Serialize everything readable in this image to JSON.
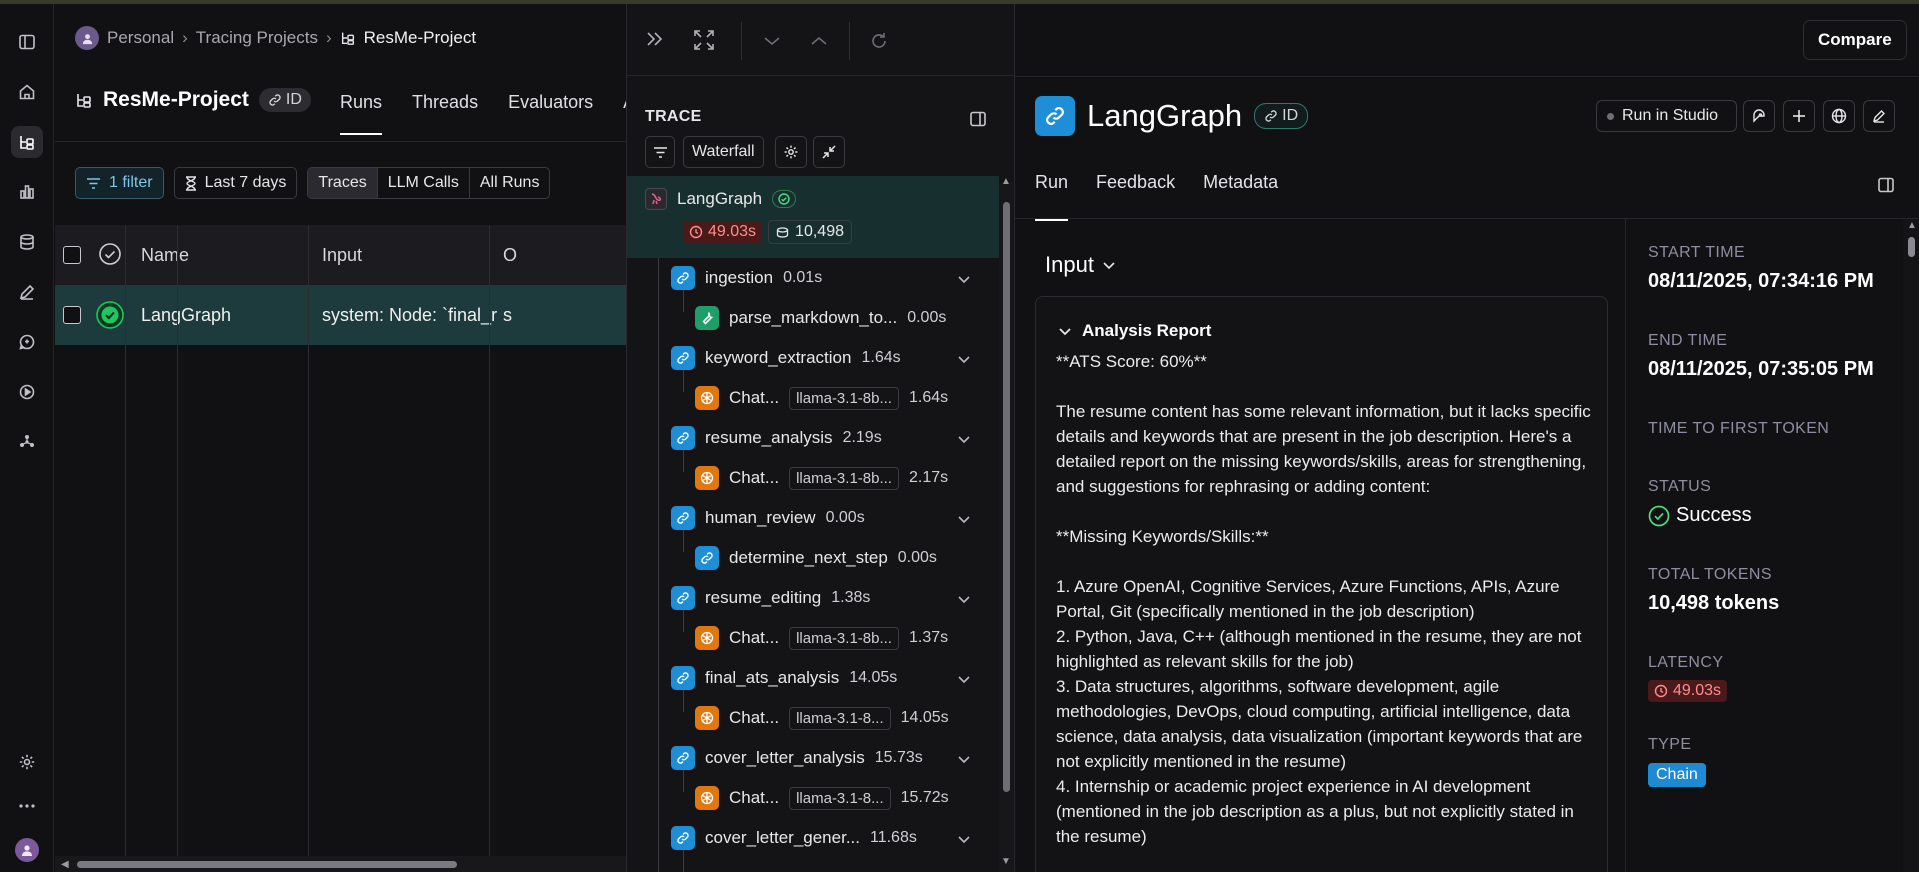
{
  "breadcrumb": {
    "root": "Personal",
    "mid": "Tracing Projects",
    "current": "ResMe-Project"
  },
  "project": {
    "title": "ResMe-Project",
    "id_label": "ID"
  },
  "project_tabs": [
    "Runs",
    "Threads",
    "Evaluators",
    "A"
  ],
  "filters": {
    "filter_label": "1 filter",
    "time_label": "Last 7 days",
    "segments": [
      "Traces",
      "LLM Calls",
      "All Runs"
    ]
  },
  "table": {
    "columns": [
      "Name",
      "Input",
      "O"
    ],
    "rows": [
      {
        "name": "LangGraph",
        "input": "system: Node: `final_r...",
        "output": "s"
      }
    ]
  },
  "trace": {
    "section_label": "TRACE",
    "view_label": "Waterfall",
    "root": {
      "name": "LangGraph",
      "latency": "49.03s",
      "tokens": "10,498"
    },
    "nodes": [
      {
        "name": "ingestion",
        "dur": "0.01s",
        "kind": "chain"
      },
      {
        "name": "parse_markdown_to...",
        "dur": "0.00s",
        "kind": "tool"
      },
      {
        "name": "keyword_extraction",
        "dur": "1.64s",
        "kind": "chain"
      },
      {
        "name": "Chat...",
        "model": "llama-3.1-8b...",
        "dur": "1.64s",
        "kind": "llm"
      },
      {
        "name": "resume_analysis",
        "dur": "2.19s",
        "kind": "chain"
      },
      {
        "name": "Chat...",
        "model": "llama-3.1-8b...",
        "dur": "2.17s",
        "kind": "llm"
      },
      {
        "name": "human_review",
        "dur": "0.00s",
        "kind": "chain"
      },
      {
        "name": "determine_next_step",
        "dur": "0.00s",
        "kind": "chain"
      },
      {
        "name": "resume_editing",
        "dur": "1.38s",
        "kind": "chain"
      },
      {
        "name": "Chat...",
        "model": "llama-3.1-8b...",
        "dur": "1.37s",
        "kind": "llm"
      },
      {
        "name": "final_ats_analysis",
        "dur": "14.05s",
        "kind": "chain"
      },
      {
        "name": "Chat...",
        "model": "llama-3.1-8...",
        "dur": "14.05s",
        "kind": "llm"
      },
      {
        "name": "cover_letter_analysis",
        "dur": "15.73s",
        "kind": "chain"
      },
      {
        "name": "Chat...",
        "model": "llama-3.1-8...",
        "dur": "15.72s",
        "kind": "llm"
      },
      {
        "name": "cover_letter_gener...",
        "dur": "11.68s",
        "kind": "chain"
      }
    ]
  },
  "detail": {
    "title": "LangGraph",
    "id_label": "ID",
    "run_in_studio": "Run in Studio",
    "compare": "Compare",
    "tabs": [
      "Run",
      "Feedback",
      "Metadata"
    ],
    "input_header": "Input",
    "report_title": "Analysis Report",
    "report_text": "**ATS Score: 60%**\n\nThe resume content has some relevant information, but it lacks specific details and keywords that are present in the job description. Here's a detailed report on the missing keywords/skills, areas for strengthening, and suggestions for rephrasing or adding content:\n\n**Missing Keywords/Skills:**\n\n1. Azure OpenAI, Cognitive Services, Azure Functions, APIs, Azure Portal, Git (specifically mentioned in the job description)\n2. Python, Java, C++ (although mentioned in the resume, they are not highlighted as relevant skills for the job)\n3. Data structures, algorithms, software development, agile methodologies, DevOps, cloud computing, artificial intelligence, data science, data analysis, data visualization (important keywords that are not explicitly mentioned in the resume)\n4. Internship or academic project experience in AI development (mentioned in the job description as a plus, but not explicitly stated in the resume)",
    "meta": {
      "start_label": "START TIME",
      "start_value": "08/11/2025, 07:34:16 PM",
      "end_label": "END TIME",
      "end_value": "08/11/2025, 07:35:05 PM",
      "ttft_label": "TIME TO FIRST TOKEN",
      "status_label": "STATUS",
      "status_value": "Success",
      "tokens_label": "TOTAL TOKENS",
      "tokens_value": "10,498 tokens",
      "latency_label": "LATENCY",
      "latency_value": "49.03s",
      "type_label": "TYPE",
      "type_value": "Chain"
    }
  },
  "colors": {
    "accent_teal": "#1d3a3c",
    "success": "#22c55e",
    "chain_blue": "#1e8fd6",
    "llm_orange": "#e0780f",
    "latency_red": "#ff8d8d"
  },
  "icons": [
    "sidebar-toggle-icon",
    "home-icon",
    "tracing-icon",
    "dashboards-icon",
    "datasets-icon",
    "annotation-icon",
    "prompts-icon",
    "deployments-icon",
    "studio-icon",
    "settings-icon",
    "more-icon",
    "user-avatar-icon"
  ]
}
